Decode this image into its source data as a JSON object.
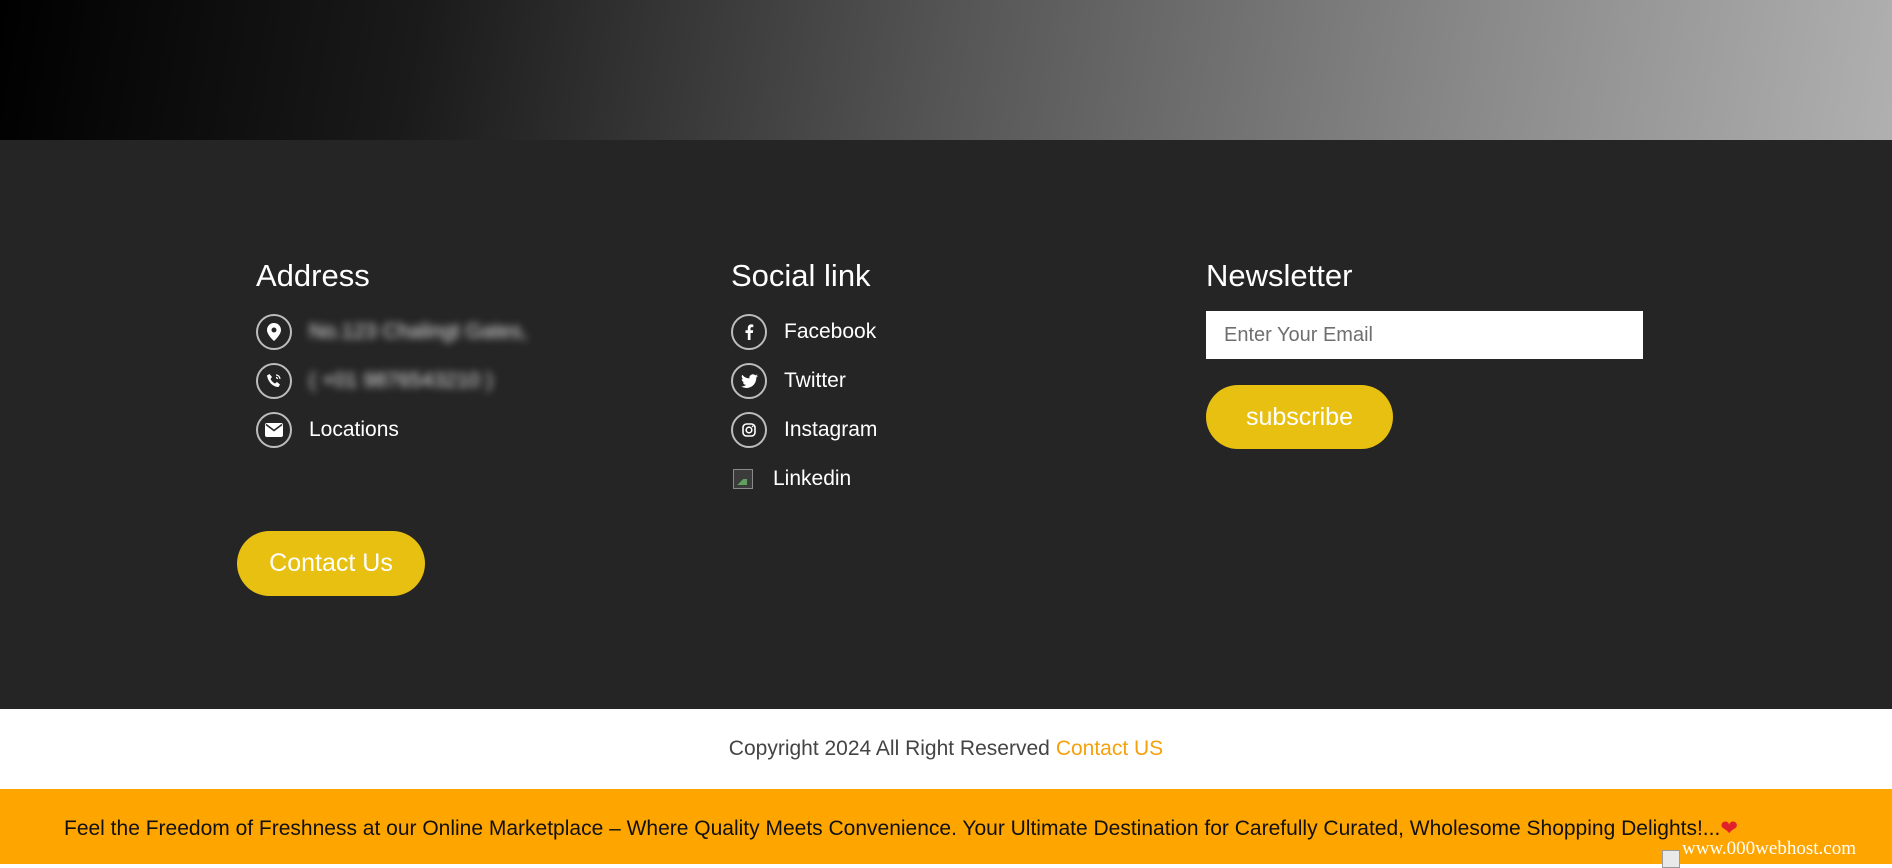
{
  "footer": {
    "address": {
      "heading": "Address",
      "street": "No.123 Chalingt Gates,",
      "phone": "( +01 9876543210 )",
      "locations_label": "Locations",
      "contact_button": "Contact Us"
    },
    "social": {
      "heading": "Social link",
      "items": [
        {
          "label": "Facebook",
          "icon": "facebook-icon"
        },
        {
          "label": "Twitter",
          "icon": "twitter-icon"
        },
        {
          "label": "Instagram",
          "icon": "instagram-icon"
        },
        {
          "label": "Linkedin",
          "icon": "broken-image-icon"
        }
      ]
    },
    "newsletter": {
      "heading": "Newsletter",
      "email_placeholder": "Enter Your Email",
      "subscribe_button": "subscribe"
    }
  },
  "copyright": {
    "text": "Copyright 2024 All Right Reserved",
    "link": "Contact US"
  },
  "marquee": {
    "text": "Feel the Freedom of Freshness at our Online Marketplace – Where Quality Meets Convenience. Your Ultimate Destination for Carefully Curated, Wholesome Shopping Delights!...",
    "heart": "❤"
  },
  "host_badge": {
    "text": "www.000webhost.com"
  },
  "colors": {
    "footer_bg": "#252525",
    "accent_yellow": "#e8c011",
    "marquee_bg": "#ffa500",
    "link_orange": "#f5a10b"
  }
}
